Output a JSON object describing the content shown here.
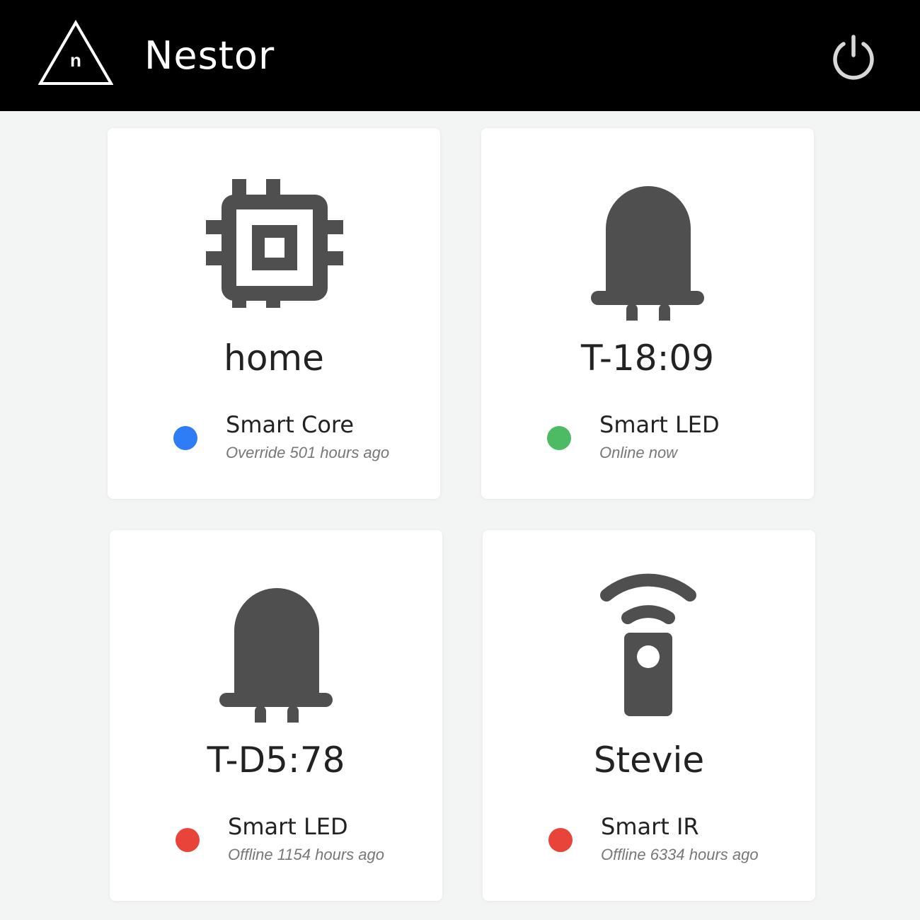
{
  "app": {
    "title": "Nestor",
    "logo_letter": "n",
    "logo_icon": "triangle-logo-icon",
    "power_icon": "power-icon"
  },
  "colors": {
    "header_bg": "#000000",
    "page_bg": "#f3f4f4",
    "icon_gray": "#4f4f4f",
    "online": "#4cbb63",
    "offline": "#e8443a",
    "override": "#2e7cf6"
  },
  "devices": [
    {
      "name": "home",
      "type": "Smart Core",
      "status": "Override 501 hours ago",
      "status_color": "#2e7cf6",
      "icon": "chip-icon"
    },
    {
      "name": "T-18:09",
      "type": "Smart LED",
      "status": "Online now",
      "status_color": "#4cbb63",
      "icon": "led-icon"
    },
    {
      "name": "T-D5:78",
      "type": "Smart LED",
      "status": "Offline 1154 hours ago",
      "status_color": "#e8443a",
      "icon": "led-icon"
    },
    {
      "name": "Stevie",
      "type": "Smart IR",
      "status": "Offline 6334 hours ago",
      "status_color": "#e8443a",
      "icon": "ir-remote-icon"
    }
  ]
}
